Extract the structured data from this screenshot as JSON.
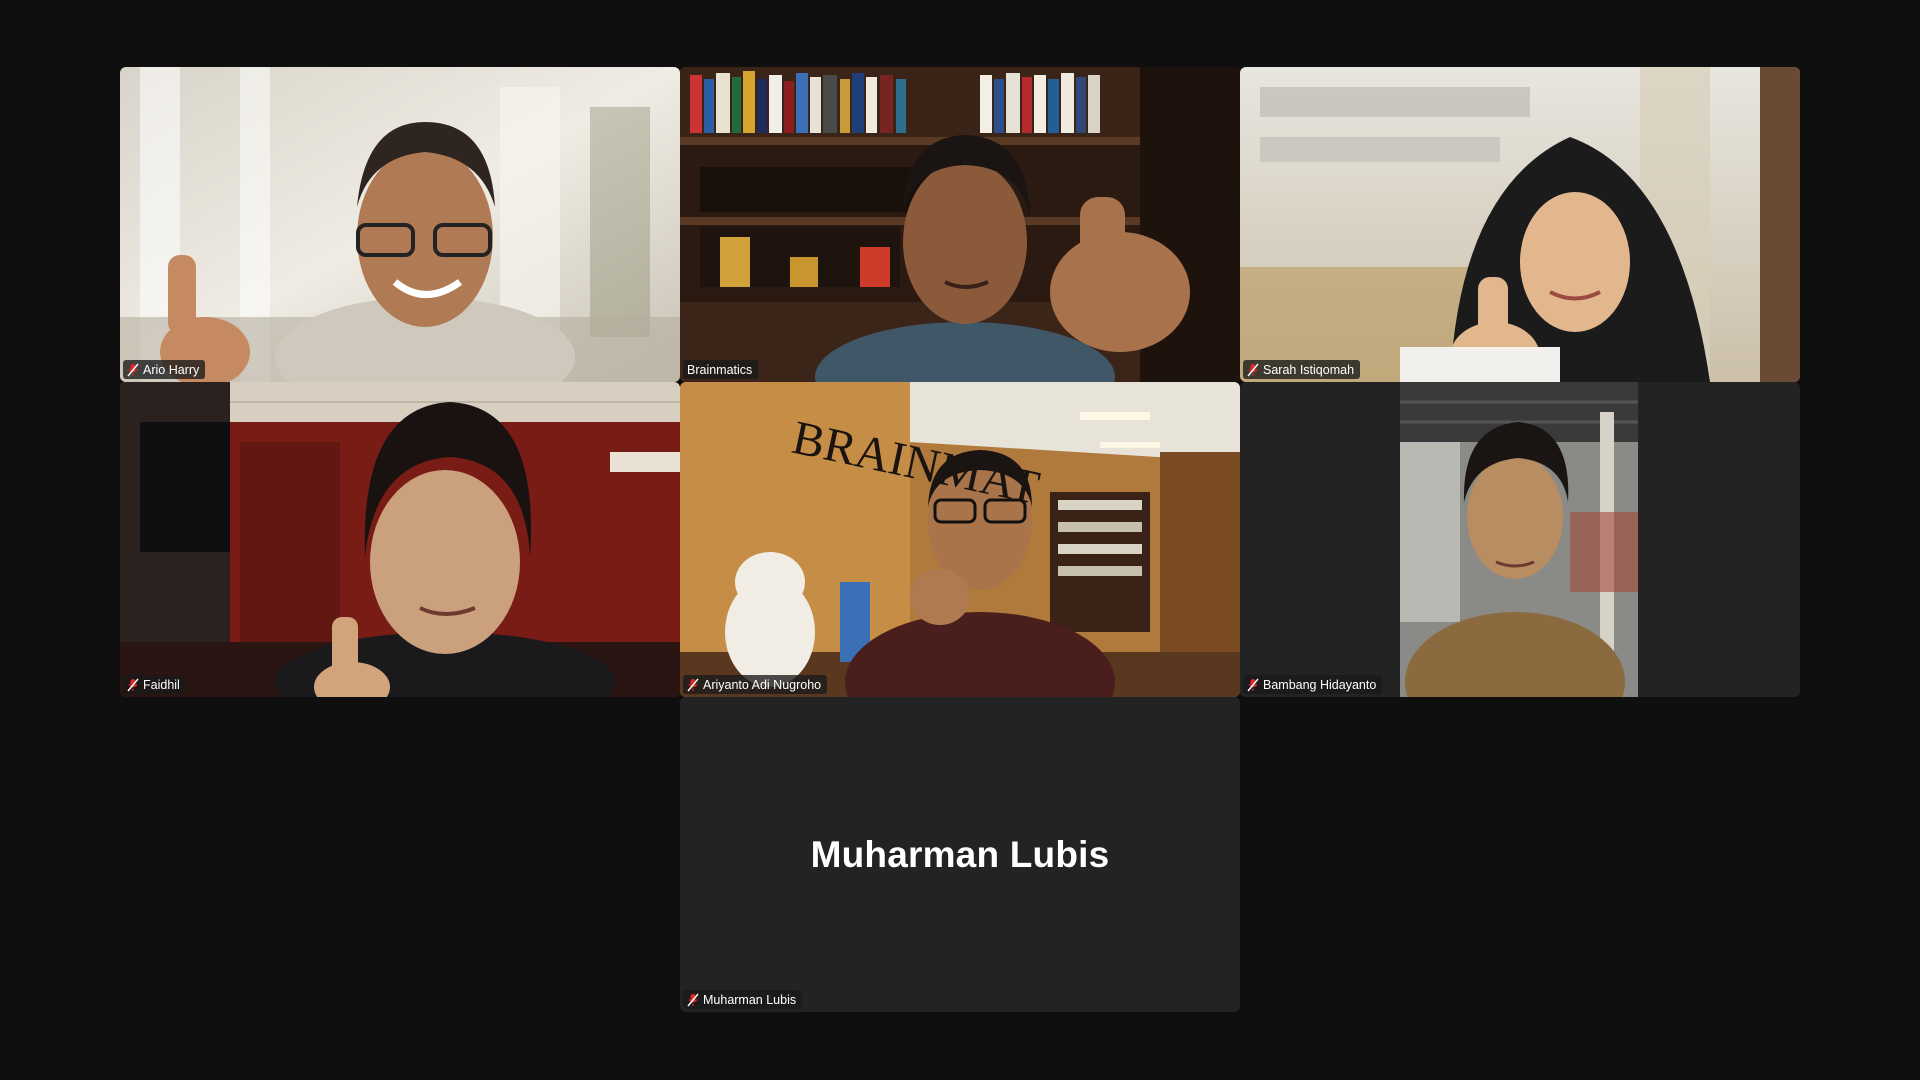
{
  "meeting": {
    "active_speaker": "Brainmatics",
    "accent_color": "#23d959",
    "muted_icon": "mic-muted-icon"
  },
  "tiles": [
    {
      "name": "Ario Harry",
      "muted": true,
      "video": true
    },
    {
      "name": "Brainmatics",
      "muted": false,
      "video": true,
      "active": true
    },
    {
      "name": "Sarah Istiqomah",
      "muted": true,
      "video": true
    },
    {
      "name": "Faidhil",
      "muted": true,
      "video": true
    },
    {
      "name": "Ariyanto Adi Nugroho",
      "muted": true,
      "video": true
    },
    {
      "name": "Bambang Hidayanto",
      "muted": true,
      "video": true
    },
    {
      "name": "Muharman Lubis",
      "muted": true,
      "video": false,
      "display_name": "Muharman Lubis"
    }
  ]
}
